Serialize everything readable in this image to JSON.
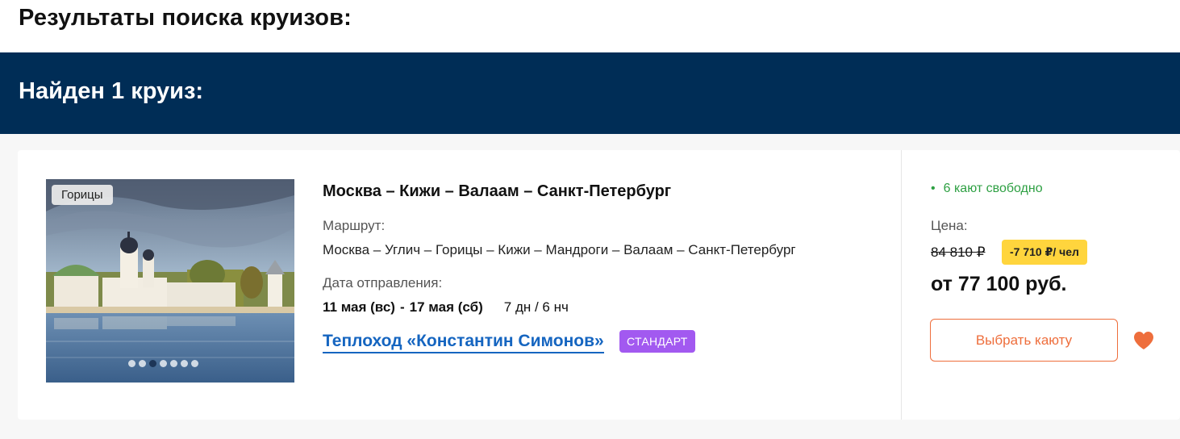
{
  "page": {
    "title": "Результаты поиска круизов:"
  },
  "results": {
    "found_title": "Найден 1 круиз:"
  },
  "cruise": {
    "photo_tag": "Горицы",
    "photo_count": 7,
    "photo_active_index": 2,
    "title": "Москва – Кижи – Валаам – Санкт-Петербург",
    "route_label": "Маршрут:",
    "route": "Москва – Углич – Горицы – Кижи – Мандроги – Валаам – Санкт-Петербург",
    "date_label": "Дата отправления:",
    "date_from": "11 мая (вс)",
    "date_separator": "-",
    "date_to": "17 мая (сб)",
    "duration": "7 дн / 6 нч",
    "ship_name": "Теплоход «Константин Симонов»",
    "ship_class": "СТАНДАРТ",
    "availability": "6 кают свободно",
    "availability_bullet": "•",
    "price_label": "Цена:",
    "old_price": "84 810 ₽",
    "discount": "-7 710 ₽/ чел",
    "price": "от 77 100 руб.",
    "select_button": "Выбрать каюту"
  },
  "colors": {
    "header_bg": "#002d56",
    "accent": "#ee6e3c",
    "link": "#1565c0",
    "available": "#2ea043",
    "ship_class_bg": "#a259f0",
    "discount_bg": "#ffd53d"
  },
  "icons": {
    "favorite": "heart-icon"
  }
}
